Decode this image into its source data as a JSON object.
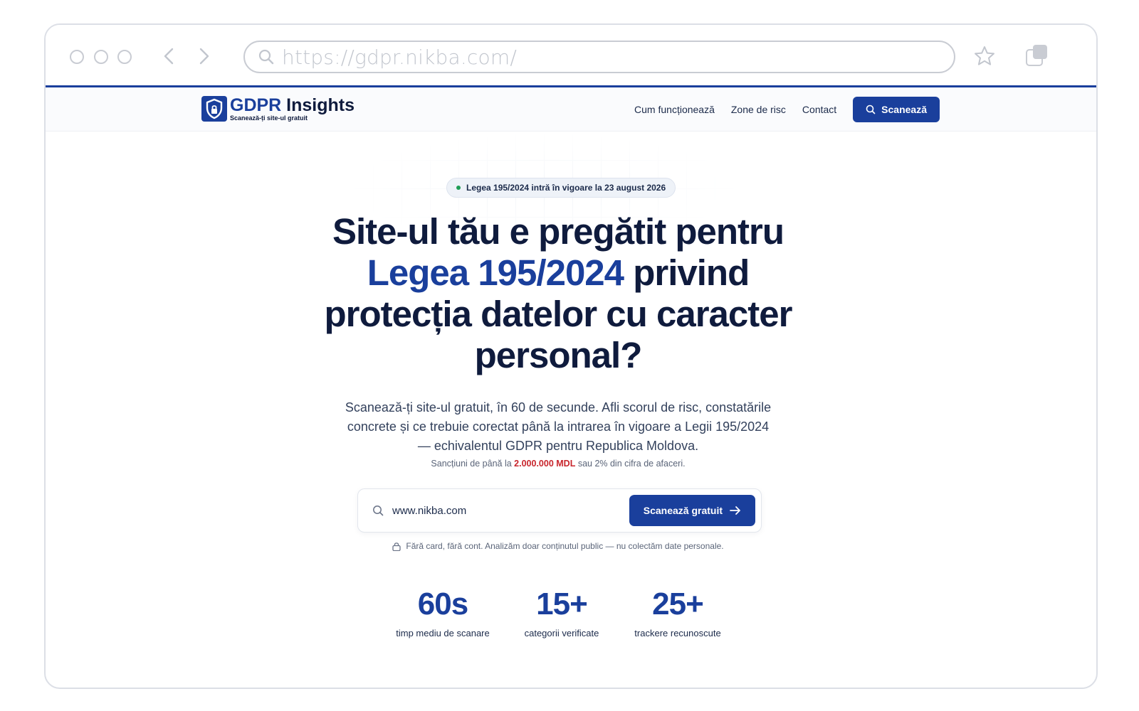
{
  "browser": {
    "url": "https://gdpr.nikba.com/",
    "icons": [
      "search-icon",
      "back-icon",
      "forward-icon",
      "star-icon",
      "tabs-icon"
    ]
  },
  "header": {
    "logo_title_gdpr": "GDPR",
    "logo_title_rest": " Insights",
    "logo_subtitle": "Scanează-ți site-ul gratuit",
    "nav": [
      {
        "label": "Cum funcționează"
      },
      {
        "label": "Zone de risc"
      },
      {
        "label": "Contact"
      }
    ],
    "cta_label": "Scanează"
  },
  "hero": {
    "badge": "Legea 195/2024 intră în vigoare la 23 august 2026",
    "headline_line1": "Site-ul tău e pregătit pentru",
    "headline_blue": "Legea 195/2024",
    "headline_after_blue": " privind",
    "headline_line3": "protecția datelor cu caracter",
    "headline_line4": "personal?",
    "lead": "Scanează-ți site-ul gratuit, în 60 de secunde. Afli scorul de risc, constatările concrete și ce trebuie corectat până la intrarea în vigoare a Legii 195/2024 — echivalentul GDPR pentru Republica Moldova.",
    "sanction_before": "Sancțiuni de până la ",
    "sanction_amount": "2.000.000 MDL",
    "sanction_after": " sau 2% din cifra de afaceri.",
    "scan_input_value": "www.nikba.com",
    "scan_button": "Scanează gratuit",
    "privacy_note": "Fără card, fără cont. Analizăm doar conținutul public — nu colectăm date personale."
  },
  "stats": [
    {
      "value": "60s",
      "label": "timp mediu de scanare"
    },
    {
      "value": "15+",
      "label": "categorii verificate"
    },
    {
      "value": "25+",
      "label": "trackere recunoscute"
    }
  ],
  "colors": {
    "brand": "#1a3f9c",
    "text": "#0f1b3d",
    "danger": "#c8252c",
    "status_dot": "#1f9d55"
  }
}
